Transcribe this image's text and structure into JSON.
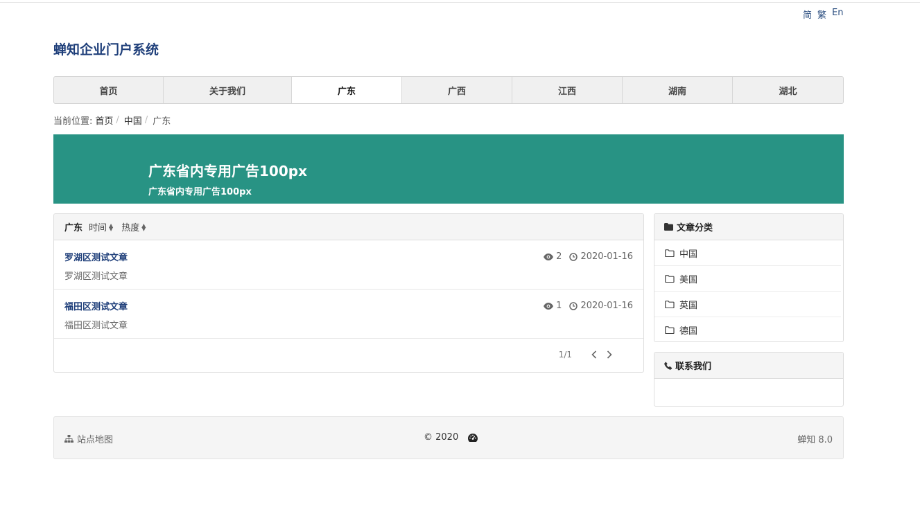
{
  "lang_switch": [
    "简",
    "繁",
    "En"
  ],
  "site_title": "蝉知企业门户系统",
  "nav": {
    "items": [
      {
        "label": "首页"
      },
      {
        "label": "关于我们"
      },
      {
        "label": "广东"
      },
      {
        "label": "广西"
      },
      {
        "label": "江西"
      },
      {
        "label": "湖南"
      },
      {
        "label": "湖北"
      }
    ],
    "active": "广东"
  },
  "breadcrumb": {
    "prefix": "当前位置:",
    "items": [
      "首页",
      "中国",
      "广东"
    ]
  },
  "banner": {
    "title": "广东省内专用广告100px",
    "subtitle": "广东省内专用广告100px",
    "bg_color": "#289384"
  },
  "article_list": {
    "category": "广东",
    "sort_time": "时间",
    "sort_hot": "热度",
    "items": [
      {
        "title": "罗湖区测试文章",
        "summary": "罗湖区测试文章",
        "views": "2",
        "date": "2020-01-16"
      },
      {
        "title": "福田区测试文章",
        "summary": "福田区测试文章",
        "views": "1",
        "date": "2020-01-16"
      }
    ],
    "pager": "1/1"
  },
  "sidebar": {
    "categories_title": "文章分类",
    "categories": [
      "中国",
      "美国",
      "英国",
      "德国"
    ],
    "contact_title": "联系我们"
  },
  "footer": {
    "sitemap": "站点地图",
    "copyright": "© 2020",
    "powered": "蝉知 8.0"
  },
  "colors": {
    "title_blue": "#1f3f7a",
    "banner_teal": "#289384"
  }
}
